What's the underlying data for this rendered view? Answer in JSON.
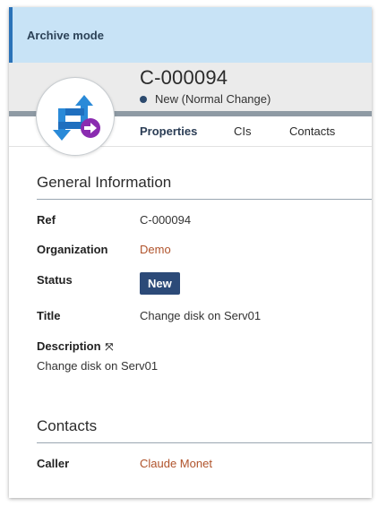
{
  "banner": {
    "text": "Archive mode"
  },
  "header": {
    "ref": "C-000094",
    "status_text": "New (Normal Change)"
  },
  "tabs": [
    {
      "label": "Properties",
      "active": true
    },
    {
      "label": "CIs",
      "active": false
    },
    {
      "label": "Contacts",
      "active": false
    }
  ],
  "general": {
    "title": "General Information",
    "ref_label": "Ref",
    "ref_value": "C-000094",
    "org_label": "Organization",
    "org_value": "Demo",
    "status_label": "Status",
    "status_value": "New",
    "title_label": "Title",
    "title_value": "Change disk on Serv01",
    "description_label": "Description",
    "description_value": "Change disk on Serv01"
  },
  "contacts": {
    "title": "Contacts",
    "caller_label": "Caller",
    "caller_value": "Claude Monet"
  },
  "colors": {
    "banner_bg": "#c8e3f6",
    "banner_accent": "#2a72b8",
    "status_badge": "#2c4a78",
    "link": "#b0532b",
    "icon_blue": "#2a8ad8",
    "icon_purple": "#8a2bb0"
  },
  "icons": [
    "change-icon",
    "expand-icon",
    "status-dot"
  ]
}
